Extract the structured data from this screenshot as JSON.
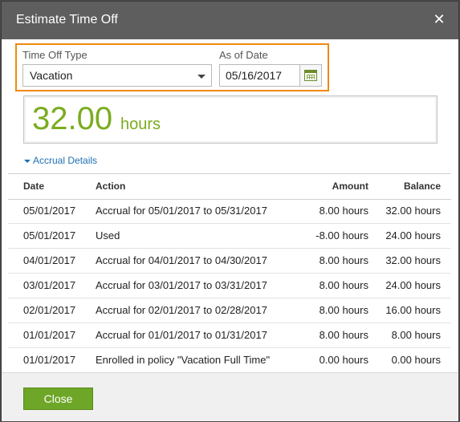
{
  "dialog": {
    "title": "Estimate Time Off",
    "close_glyph": "✕"
  },
  "filters": {
    "type_label": "Time Off Type",
    "type_value": "Vacation",
    "date_label": "As of Date",
    "date_value": "05/16/2017",
    "calendar_icon": "calendar-icon"
  },
  "summary": {
    "hours_value": "32.00",
    "hours_unit": "hours"
  },
  "accrual_link": "Accrual Details",
  "table": {
    "headers": {
      "date": "Date",
      "action": "Action",
      "amount": "Amount",
      "balance": "Balance"
    },
    "rows": [
      {
        "date": "05/01/2017",
        "action": "Accrual for 05/01/2017 to 05/31/2017",
        "amount": "8.00 hours",
        "balance": "32.00 hours"
      },
      {
        "date": "05/01/2017",
        "action": "Used",
        "amount": "-8.00 hours",
        "balance": "24.00 hours"
      },
      {
        "date": "04/01/2017",
        "action": "Accrual for 04/01/2017 to 04/30/2017",
        "amount": "8.00 hours",
        "balance": "32.00 hours"
      },
      {
        "date": "03/01/2017",
        "action": "Accrual for 03/01/2017 to 03/31/2017",
        "amount": "8.00 hours",
        "balance": "24.00 hours"
      },
      {
        "date": "02/01/2017",
        "action": "Accrual for 02/01/2017 to 02/28/2017",
        "amount": "8.00 hours",
        "balance": "16.00 hours"
      },
      {
        "date": "01/01/2017",
        "action": "Accrual for 01/01/2017 to 01/31/2017",
        "amount": "8.00 hours",
        "balance": "8.00 hours"
      },
      {
        "date": "01/01/2017",
        "action": "Enrolled in policy \"Vacation Full Time\"",
        "amount": "0.00 hours",
        "balance": "0.00 hours"
      }
    ]
  },
  "footer": {
    "close_label": "Close"
  },
  "colors": {
    "accent_green": "#7aac1f",
    "highlight_orange": "#f0890f",
    "link_blue": "#1f6fb3",
    "title_bar": "#5e5e5e"
  }
}
